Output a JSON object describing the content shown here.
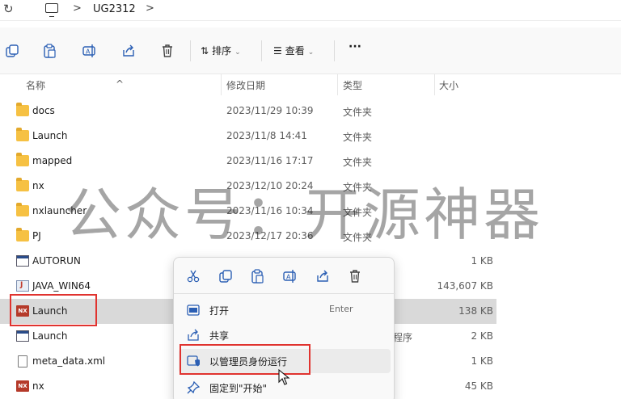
{
  "address_bar": {
    "refresh_icon": "refresh-icon",
    "computer_icon": "computer-icon",
    "separator": ">",
    "breadcrumb": "UG2312"
  },
  "toolbar": {
    "copy_icon": "copy-icon",
    "paste_icon": "paste-icon",
    "rename_icon": "rename-icon",
    "share_icon": "share-icon",
    "delete_icon": "delete-icon",
    "sort_label": "排序",
    "view_label": "查看",
    "more_label": "···"
  },
  "columns": {
    "name": "名称",
    "date": "修改日期",
    "type": "类型",
    "size": "大小"
  },
  "files": [
    {
      "name": "docs",
      "date": "2023/11/29 10:39",
      "type": "文件夹",
      "size": "",
      "icon": "folder-icon"
    },
    {
      "name": "Launch",
      "date": "2023/11/8 14:41",
      "type": "文件夹",
      "size": "",
      "icon": "folder-icon"
    },
    {
      "name": "mapped",
      "date": "2023/11/16 17:17",
      "type": "文件夹",
      "size": "",
      "icon": "folder-icon"
    },
    {
      "name": "nx",
      "date": "2023/12/10 20:24",
      "type": "文件夹",
      "size": "",
      "icon": "folder-icon"
    },
    {
      "name": "nxlauncher",
      "date": "2023/11/16 10:34",
      "type": "文件夹",
      "size": "",
      "icon": "folder-icon"
    },
    {
      "name": "PJ",
      "date": "2023/12/17 20:36",
      "type": "文件夹",
      "size": "",
      "icon": "folder-icon"
    },
    {
      "name": "AUTORUN",
      "date": "",
      "type": "",
      "size": "1 KB",
      "icon": "autorun-file-icon"
    },
    {
      "name": "JAVA_WIN64",
      "date": "",
      "type": "",
      "size": "143,607 KB",
      "icon": "java-file-icon"
    },
    {
      "name": "Launch",
      "date": "",
      "type": "",
      "size": "138 KB",
      "icon": "nx-app-icon"
    },
    {
      "name": "Launch",
      "date": "",
      "type": "程序",
      "size": "2 KB",
      "icon": "window-app-icon"
    },
    {
      "name": "meta_data.xml",
      "date": "",
      "type": "",
      "size": "1 KB",
      "icon": "document-icon"
    },
    {
      "name": "nx",
      "date": "",
      "type": "",
      "size": "45 KB",
      "icon": "nx-app-icon"
    }
  ],
  "context_menu": {
    "quick_actions": [
      "cut-icon",
      "copy-icon",
      "paste-icon",
      "rename-icon",
      "share-icon",
      "delete-icon"
    ],
    "items": [
      {
        "label": "打开",
        "shortcut": "Enter",
        "icon": "open-icon"
      },
      {
        "label": "共享",
        "shortcut": "",
        "icon": "share-icon"
      },
      {
        "label": "以管理员身份运行",
        "shortcut": "",
        "icon": "admin-shield-icon"
      },
      {
        "label": "固定到\"开始\"",
        "shortcut": "",
        "icon": "pin-icon"
      }
    ]
  },
  "watermark": "公众号：开源神器",
  "colors": {
    "selection": "#d9d9d9",
    "highlight_box": "#e0332f",
    "folder": "#f6c143",
    "nx_brand": "#b53a2a"
  }
}
